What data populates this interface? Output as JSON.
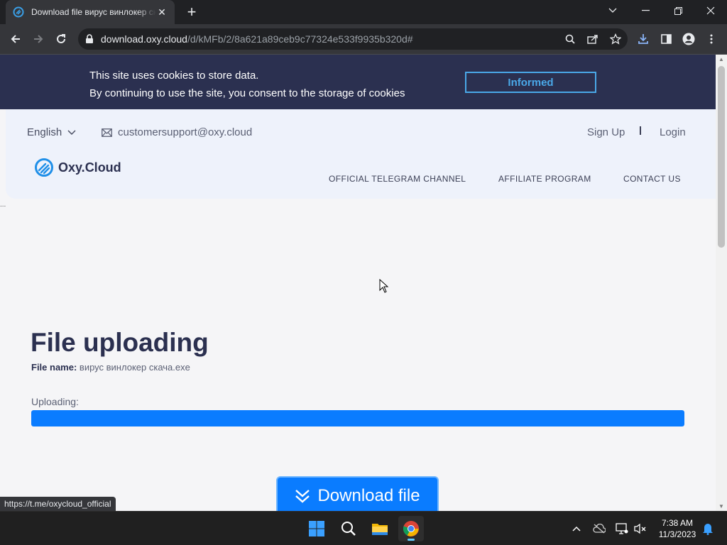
{
  "browser": {
    "tab_title": "Download file вирус винлокер скача",
    "tab_close": "✕",
    "new_tab": "+",
    "url_host": "download.oxy.cloud",
    "url_path": "/d/kMFb/2/8a621a89ceb9c77324e533f9935b320d#",
    "status_url": "https://t.me/oxycloud_official"
  },
  "cookie_banner": {
    "line1": "This site uses cookies to store data.",
    "line2": "By continuing to use the site, you consent to the storage of cookies",
    "button": "Informed"
  },
  "header": {
    "language": "English",
    "email": "customersupport@oxy.cloud",
    "sign_up": "Sign Up",
    "login": "Login",
    "logo_text": "Oxy.Cloud",
    "nav": [
      "OFFICIAL TELEGRAM CHANNEL",
      "AFFILIATE PROGRAM",
      "CONTACT US"
    ]
  },
  "main": {
    "dots": "...",
    "title": "File uploading",
    "file_name_label": "File name:",
    "file_name": "вирус винлокер скача.exe",
    "uploading_label": "Uploading:",
    "progress": 1.0,
    "download_button": "Download file"
  },
  "taskbar": {
    "time": "7:38 AM",
    "date": "11/3/2023"
  },
  "colors": {
    "banner": "#2b3050",
    "accent": "#0a7cff",
    "informed": "#4aa8e8"
  }
}
